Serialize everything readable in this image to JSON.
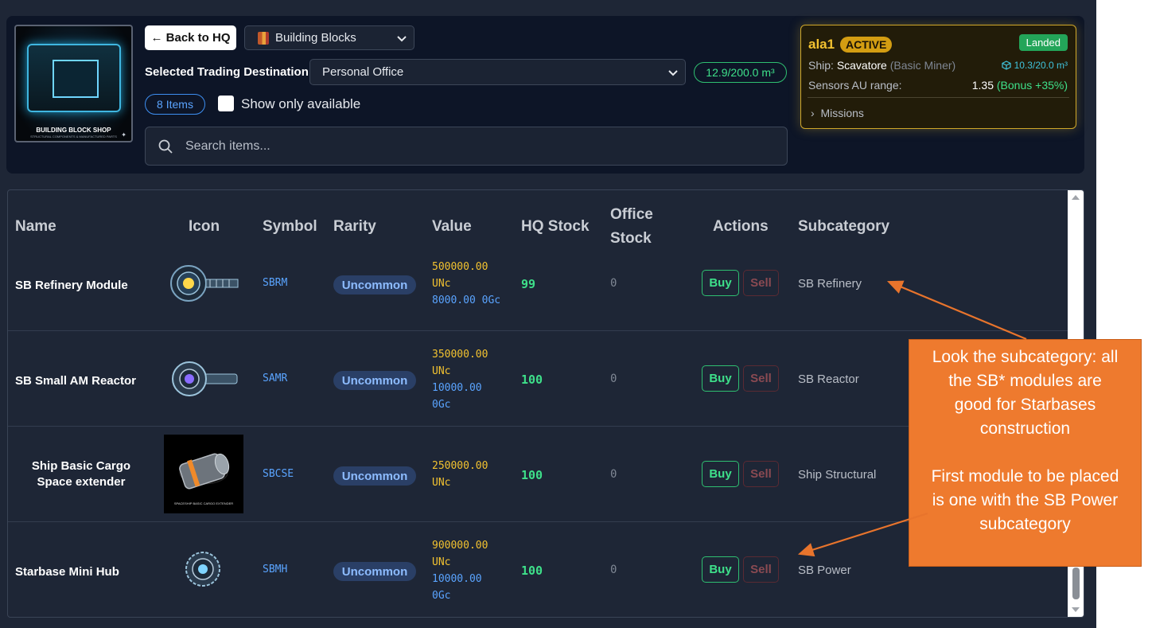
{
  "shop": {
    "thumb_title": "BUILDING BLOCK SHOP",
    "thumb_subtitle": "STRUCTURAL COMPONENTS & MANUFACTURED PARTS",
    "back_label": "← Back to HQ",
    "category": "Building Blocks",
    "dest_label": "Selected Trading Destination:",
    "destination": "Personal Office",
    "capacity": "12.9/200.0 m³",
    "items_count": "8 Items",
    "show_available_label": "Show only available",
    "search_placeholder": "Search items..."
  },
  "ship_card": {
    "name": "ala1",
    "status": "ACTIVE",
    "landed": "Landed",
    "ship_label": "Ship:",
    "ship_name": "Scavatore",
    "ship_type": "(Basic Miner)",
    "cargo": "10.3/20.0 m³",
    "sensors_label": "Sensors AU range:",
    "sensors_value": "1.35",
    "sensors_bonus": "(Bonus +35%)",
    "missions_label": "Missions",
    "colors": {
      "border": "#d0a82a",
      "active": "#d39d12",
      "landed": "#23a559"
    }
  },
  "table": {
    "headers": {
      "name": "Name",
      "icon": "Icon",
      "symbol": "Symbol",
      "rarity": "Rarity",
      "value": "Value",
      "hq_stock": "HQ Stock",
      "office_stock_1": "Office",
      "office_stock_2": "Stock",
      "actions": "Actions",
      "subcategory": "Subcategory"
    },
    "buy_label": "Buy",
    "sell_label": "Sell",
    "rows": [
      {
        "name": "SB Refinery Module",
        "symbol": "SBRM",
        "rarity": "Uncommon",
        "value_unc_1": "500000.00",
        "value_unc_2": "UNc",
        "value_ogc_1": "8000.00 0Gc",
        "value_ogc_2": "",
        "hq_stock": "99",
        "office_stock": "0",
        "subcategory": "SB Refinery",
        "icon": "refinery-module-icon"
      },
      {
        "name": "SB Small AM Reactor",
        "symbol": "SAMR",
        "rarity": "Uncommon",
        "value_unc_1": "350000.00",
        "value_unc_2": "UNc",
        "value_ogc_1": "10000.00",
        "value_ogc_2": "0Gc",
        "hq_stock": "100",
        "office_stock": "0",
        "subcategory": "SB Reactor",
        "icon": "reactor-icon"
      },
      {
        "name": "Ship Basic Cargo Space extender",
        "symbol": "SBCSE",
        "rarity": "Uncommon",
        "value_unc_1": "250000.00",
        "value_unc_2": "UNc",
        "value_ogc_1": "",
        "value_ogc_2": "",
        "hq_stock": "100",
        "office_stock": "0",
        "subcategory": "Ship Structural",
        "icon": "cargo-extender-icon",
        "icon_caption": "SPACESHIP BASIC CARGO EXTENDER"
      },
      {
        "name": "Starbase Mini Hub",
        "symbol": "SBMH",
        "rarity": "Uncommon",
        "value_unc_1": "900000.00",
        "value_unc_2": "UNc",
        "value_ogc_1": "10000.00",
        "value_ogc_2": "0Gc",
        "hq_stock": "100",
        "office_stock": "0",
        "subcategory": "SB Power",
        "icon": "mini-hub-icon"
      }
    ]
  },
  "callout": {
    "line1": "Look the subcategory:  all",
    "line2": "the SB* modules   are",
    "line3": "good for Starbases",
    "line4": "construction",
    "line5": "First module to be placed",
    "line6": "is one with the SB Power",
    "line7": "subcategory",
    "color": "#ee7a2e"
  }
}
